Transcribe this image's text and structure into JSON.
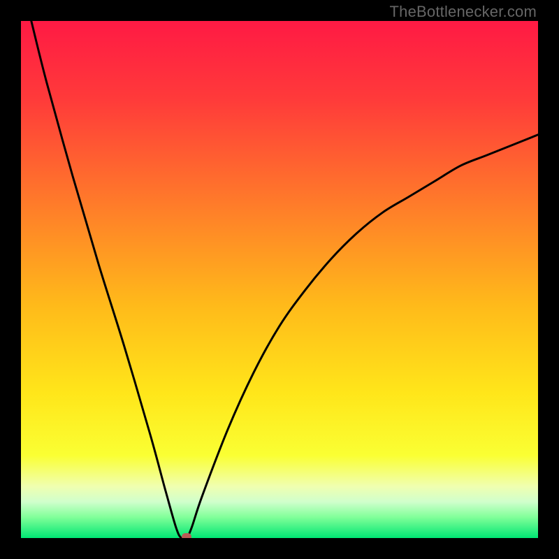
{
  "watermark": {
    "text": "TheBottlenecker.com"
  },
  "colors": {
    "frame": "#000000",
    "curve": "#000000",
    "marker": "#b95c55",
    "watermark": "#666666",
    "gradient_stops": [
      {
        "pct": 0,
        "color": "#ff1a44"
      },
      {
        "pct": 15,
        "color": "#ff3a3a"
      },
      {
        "pct": 35,
        "color": "#ff7a2a"
      },
      {
        "pct": 55,
        "color": "#ffba1a"
      },
      {
        "pct": 72,
        "color": "#ffe61a"
      },
      {
        "pct": 84,
        "color": "#faff33"
      },
      {
        "pct": 90,
        "color": "#f0ffb0"
      },
      {
        "pct": 93,
        "color": "#d0ffcc"
      },
      {
        "pct": 96,
        "color": "#80ff99"
      },
      {
        "pct": 100,
        "color": "#00e673"
      }
    ]
  },
  "chart_data": {
    "type": "line",
    "title": "",
    "xlabel": "",
    "ylabel": "",
    "xlim": [
      0,
      100
    ],
    "ylim": [
      0,
      100
    ],
    "x": [
      2,
      5,
      10,
      15,
      20,
      25,
      28,
      30,
      31,
      32,
      33,
      35,
      40,
      45,
      50,
      55,
      60,
      65,
      70,
      75,
      80,
      85,
      90,
      95,
      100
    ],
    "values": [
      100,
      88,
      70,
      53,
      37,
      20,
      9,
      2,
      0,
      0,
      2,
      8,
      21,
      32,
      41,
      48,
      54,
      59,
      63,
      66,
      69,
      72,
      74,
      76,
      78
    ],
    "marker": {
      "x": 32,
      "y": 0
    },
    "note": "V-shaped bottleneck curve; x is relative configuration axis (0-100), y is bottleneck percentage (0 = none, 100 = full). Minimum at x≈32 marked by red dot."
  }
}
